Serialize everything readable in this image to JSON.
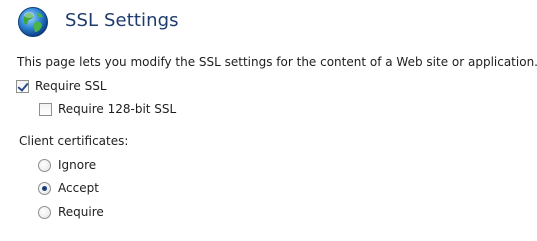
{
  "header": {
    "title": "SSL Settings",
    "icon": "globe-icon"
  },
  "description": "This page lets you modify the SSL settings for the content of a Web site or application.",
  "ssl": {
    "require_ssl": {
      "label": "Require SSL",
      "checked": true
    },
    "require_128": {
      "label": "Require 128-bit SSL",
      "checked": false
    }
  },
  "client_certificates": {
    "label": "Client certificates:",
    "options": [
      {
        "label": "Ignore",
        "selected": false
      },
      {
        "label": "Accept",
        "selected": true
      },
      {
        "label": "Require",
        "selected": false
      }
    ]
  },
  "colors": {
    "title": "#1e3b6e",
    "accent": "#2b4a8a"
  }
}
